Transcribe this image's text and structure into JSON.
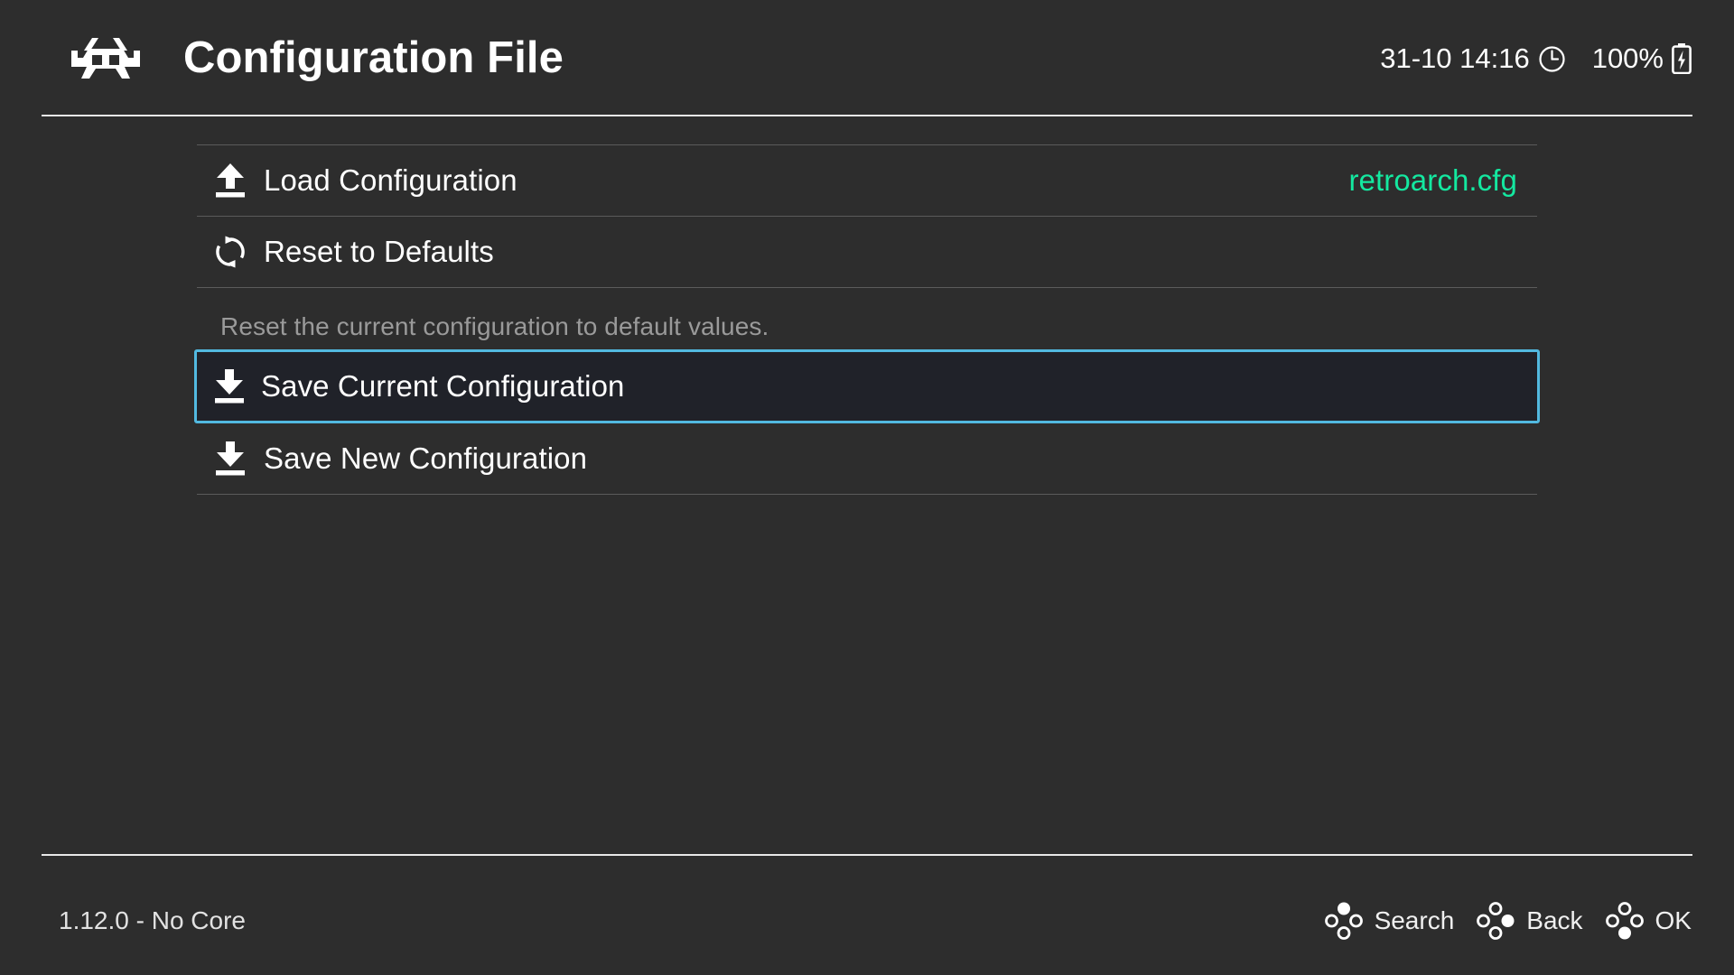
{
  "header": {
    "logo_icon": "retroarch-invader-logo",
    "title": "Configuration File",
    "clock_text": "31-10 14:16",
    "clock_icon": "clock-icon",
    "battery_text": "100%",
    "battery_icon": "battery-charging-icon"
  },
  "menu": {
    "items": [
      {
        "label": "Load Configuration",
        "icon": "upload-icon",
        "value": "retroarch.cfg",
        "selected": false
      },
      {
        "label": "Reset to Defaults",
        "icon": "reset-refresh-icon",
        "value": "",
        "selected": false
      },
      {
        "label": "Save Current Configuration",
        "icon": "download-icon",
        "value": "",
        "selected": true
      },
      {
        "label": "Save New Configuration",
        "icon": "download-icon",
        "value": "",
        "selected": false
      }
    ],
    "help_text": "Reset the current configuration to default values."
  },
  "footer": {
    "version": "1.12.0 - No Core",
    "actions": [
      {
        "label": "Search",
        "icon": "gamepad-button-top-icon"
      },
      {
        "label": "Back",
        "icon": "gamepad-button-right-icon"
      },
      {
        "label": "OK",
        "icon": "gamepad-button-bottom-icon"
      }
    ]
  },
  "colors": {
    "background": "#2d2d2d",
    "accent_value": "#14e8a0",
    "selection_border": "#52b9e0",
    "selection_fill": "#202229",
    "help_text": "#9a9a9a",
    "divider": "#e8e8e8",
    "separator": "#5b5b5b"
  }
}
